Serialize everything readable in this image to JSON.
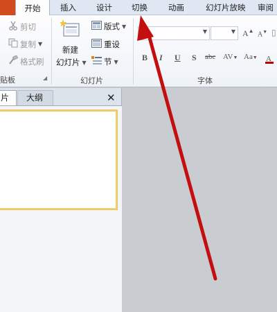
{
  "tabs": [
    {
      "label": "开始",
      "active": true
    },
    {
      "label": "插入"
    },
    {
      "label": "设计"
    },
    {
      "label": "切换"
    },
    {
      "label": "动画"
    },
    {
      "label": "幻灯片放映"
    },
    {
      "label": "审阅"
    }
  ],
  "ribbon": {
    "clipboard": {
      "cut": "剪切",
      "copy": "复制",
      "format_painter": "格式刷",
      "group_label": "贴板"
    },
    "slides": {
      "new_slide_line1": "新建",
      "new_slide_line2": "幻灯片",
      "layout": "版式",
      "reset": "重设",
      "section": "节",
      "group_label": "幻灯片"
    },
    "font": {
      "group_label": "字体",
      "bold": "B",
      "italic": "I",
      "underline": "U",
      "shadow": "S",
      "strikethrough": "abc",
      "spacing": "AV",
      "change_case": "Aa",
      "grow": "A",
      "shrink": "A"
    }
  },
  "slide_pane": {
    "tab_slides": "片",
    "tab_outline": "大纲",
    "close": "✕"
  },
  "colors": {
    "file_tab": "#d24b1f",
    "arrow": "#c30f10",
    "thumb_border": "#f3cf6c"
  }
}
